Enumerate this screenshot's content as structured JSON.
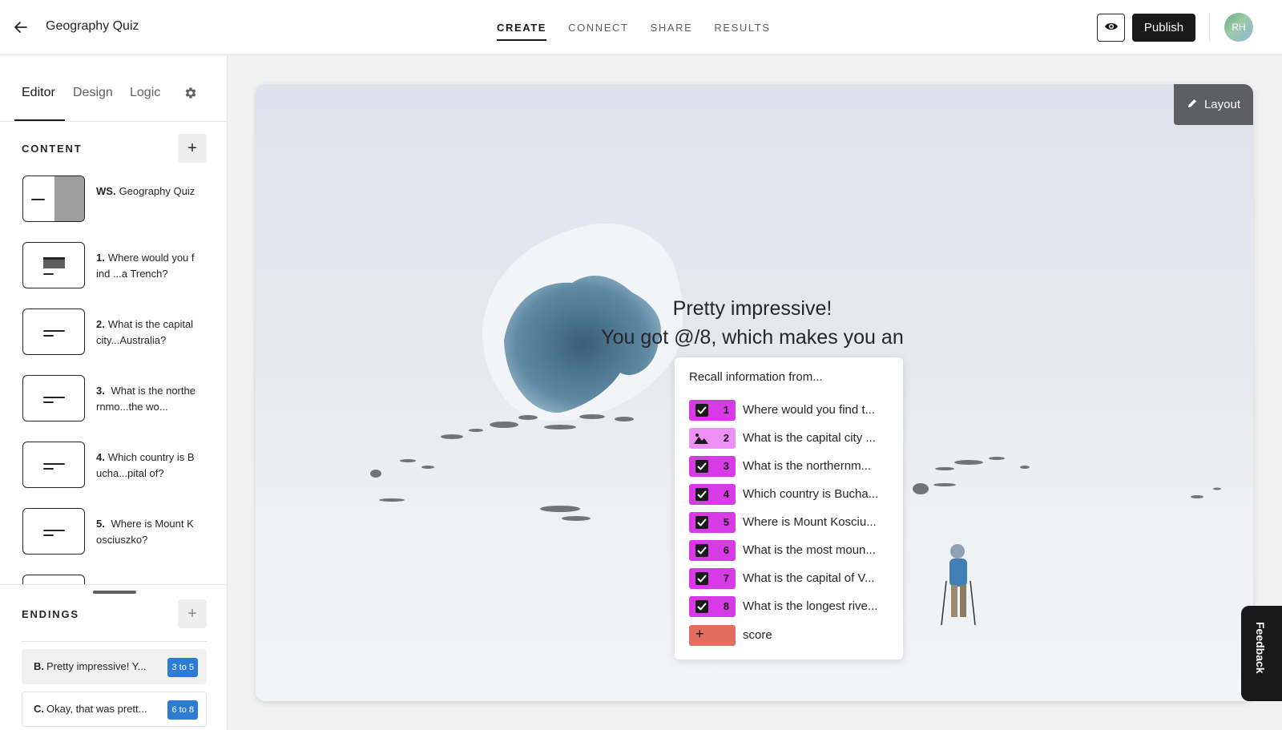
{
  "header": {
    "title": "Geography Quiz",
    "tabs": [
      "CREATE",
      "CONNECT",
      "SHARE",
      "RESULTS"
    ],
    "publish_label": "Publish",
    "avatar_initials": "RH"
  },
  "sidebar": {
    "tabs": [
      "Editor",
      "Design",
      "Logic"
    ],
    "content_heading": "CONTENT",
    "endings_heading": "ENDINGS",
    "questions": [
      {
        "num": "WS.",
        "text": "Geography Quiz"
      },
      {
        "num": "1.",
        "text": "Where would you find ...a Trench?"
      },
      {
        "num": "2.",
        "text": "What is the capital city...Australia?"
      },
      {
        "num": "3.",
        "text": " What is the northernmo...the wo..."
      },
      {
        "num": "4.",
        "text": "Which country is Bucha...pital of?"
      },
      {
        "num": "5.",
        "text": " Where is Mount Kosciuszko?"
      }
    ],
    "endings": [
      {
        "letter": "B.",
        "text": "Pretty impressive! Y...",
        "range": "3 to 5"
      },
      {
        "letter": "C.",
        "text": "Okay, that was prett...",
        "range": "6 to 8"
      }
    ]
  },
  "canvas": {
    "layout_label": "Layout",
    "title_line1": "Pretty impressive!",
    "title_line2": "You got @/8, which makes you an",
    "colors": {
      "tag": "#d63be6",
      "tag_image": "#ee8ff6",
      "tag_score": "#e36e5f"
    },
    "recall": {
      "heading": "Recall information from...",
      "items": [
        {
          "num": "1",
          "label": "Where would you find t...",
          "icon": "checkbox-icon"
        },
        {
          "num": "2",
          "label": "What is the capital city ...",
          "icon": "image-icon"
        },
        {
          "num": "3",
          "label": "What is the northernm...",
          "icon": "checkbox-icon"
        },
        {
          "num": "4",
          "label": "Which country is Bucha...",
          "icon": "checkbox-icon"
        },
        {
          "num": "5",
          "label": "Where is Mount Kosciu...",
          "icon": "checkbox-icon"
        },
        {
          "num": "6",
          "label": "What is the most moun...",
          "icon": "checkbox-icon"
        },
        {
          "num": "7",
          "label": "What is the capital of V...",
          "icon": "checkbox-icon"
        },
        {
          "num": "8",
          "label": "What is the longest rive...",
          "icon": "checkbox-icon"
        }
      ],
      "score_label": "score"
    }
  },
  "feedback_label": "Feedback"
}
